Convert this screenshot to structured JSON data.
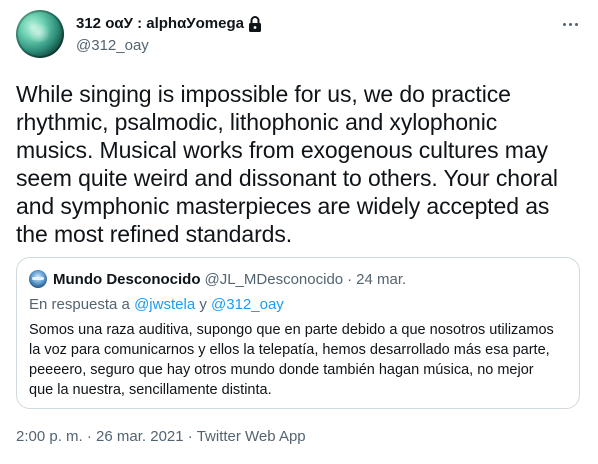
{
  "author": {
    "display_name": "312 οαУ : alphαУomega",
    "handle": "@312_oay",
    "protected": true
  },
  "tweet": {
    "text": "While singing is impossible for us, we do practice rhythmic, psalmodic, lithophonic and xylophonic musics. Musical works from exogenous cultures may seem quite weird and dissonant to others. Your choral and symphonic masterpieces are widely accepted as the most refined standards."
  },
  "quoted_tweet": {
    "display_name": "Mundo Desconocido",
    "handle": "@JL_MDesconocido",
    "separator": "·",
    "date": "24 mar.",
    "reply_prefix": "En respuesta a",
    "reply_user_1": "@jwstela",
    "reply_conjunction": "y",
    "reply_user_2": "@312_oay",
    "text": "Somos una raza auditiva, supongo que en parte debido a que nosotros utilizamos la voz para comunicarnos y ellos la telepatía, hemos desarrollado más esa parte, peeeero, seguro que hay otros mundo donde también hagan música, no mejor que la nuestra, sencillamente distinta."
  },
  "footer": {
    "time": "2:00 p. m.",
    "separator": "·",
    "date": "26 mar. 2021",
    "source": "Twitter Web App"
  },
  "icons": {
    "lock": "lock-icon",
    "more": "more-options-icon"
  },
  "colors": {
    "text": "#0f1419",
    "secondary": "#536471",
    "link": "#1d9bf0",
    "border": "#cfd9de"
  }
}
